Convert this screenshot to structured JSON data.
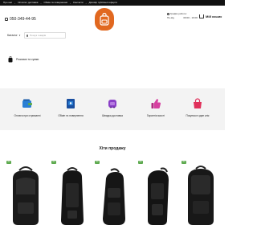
{
  "topbar": {
    "links": [
      "Про нас",
      "Оплата і доставка",
      "Обмін та повернення",
      "Контакти",
      "Договір публічної оферти"
    ]
  },
  "header": {
    "phone": "050-349-44-95",
    "hours_title": "Графік роботи:",
    "hours_days": "Пн-Нд",
    "hours_time": "09:00 - 19:00",
    "cart_label": "Мій кошик"
  },
  "catalog": {
    "label": "Каталог"
  },
  "search": {
    "placeholder": "Пошук товарів"
  },
  "category": {
    "label": "Рюкзаки та сумки"
  },
  "features": [
    {
      "label": "Оплата при отриманні",
      "icon": "wallet-icon",
      "color": "#2a7fd4"
    },
    {
      "label": "Обмін та повернення",
      "icon": "return-icon",
      "color": "#1a4fa0"
    },
    {
      "label": "Швидка доставка",
      "icon": "delivery-icon",
      "color": "#8a3fc7"
    },
    {
      "label": "Гарантія якості",
      "icon": "thumbs-up-icon",
      "color": "#d63fa0"
    },
    {
      "label": "Покупка в один клік",
      "icon": "shopping-bag-icon",
      "color": "#e0305a"
    }
  ],
  "bestsellers": {
    "title": "Хіти продажу",
    "badge": "Хіт"
  },
  "colors": {
    "topbar": "#111111",
    "logo": "#e16820",
    "badge": "#5aa84b"
  }
}
